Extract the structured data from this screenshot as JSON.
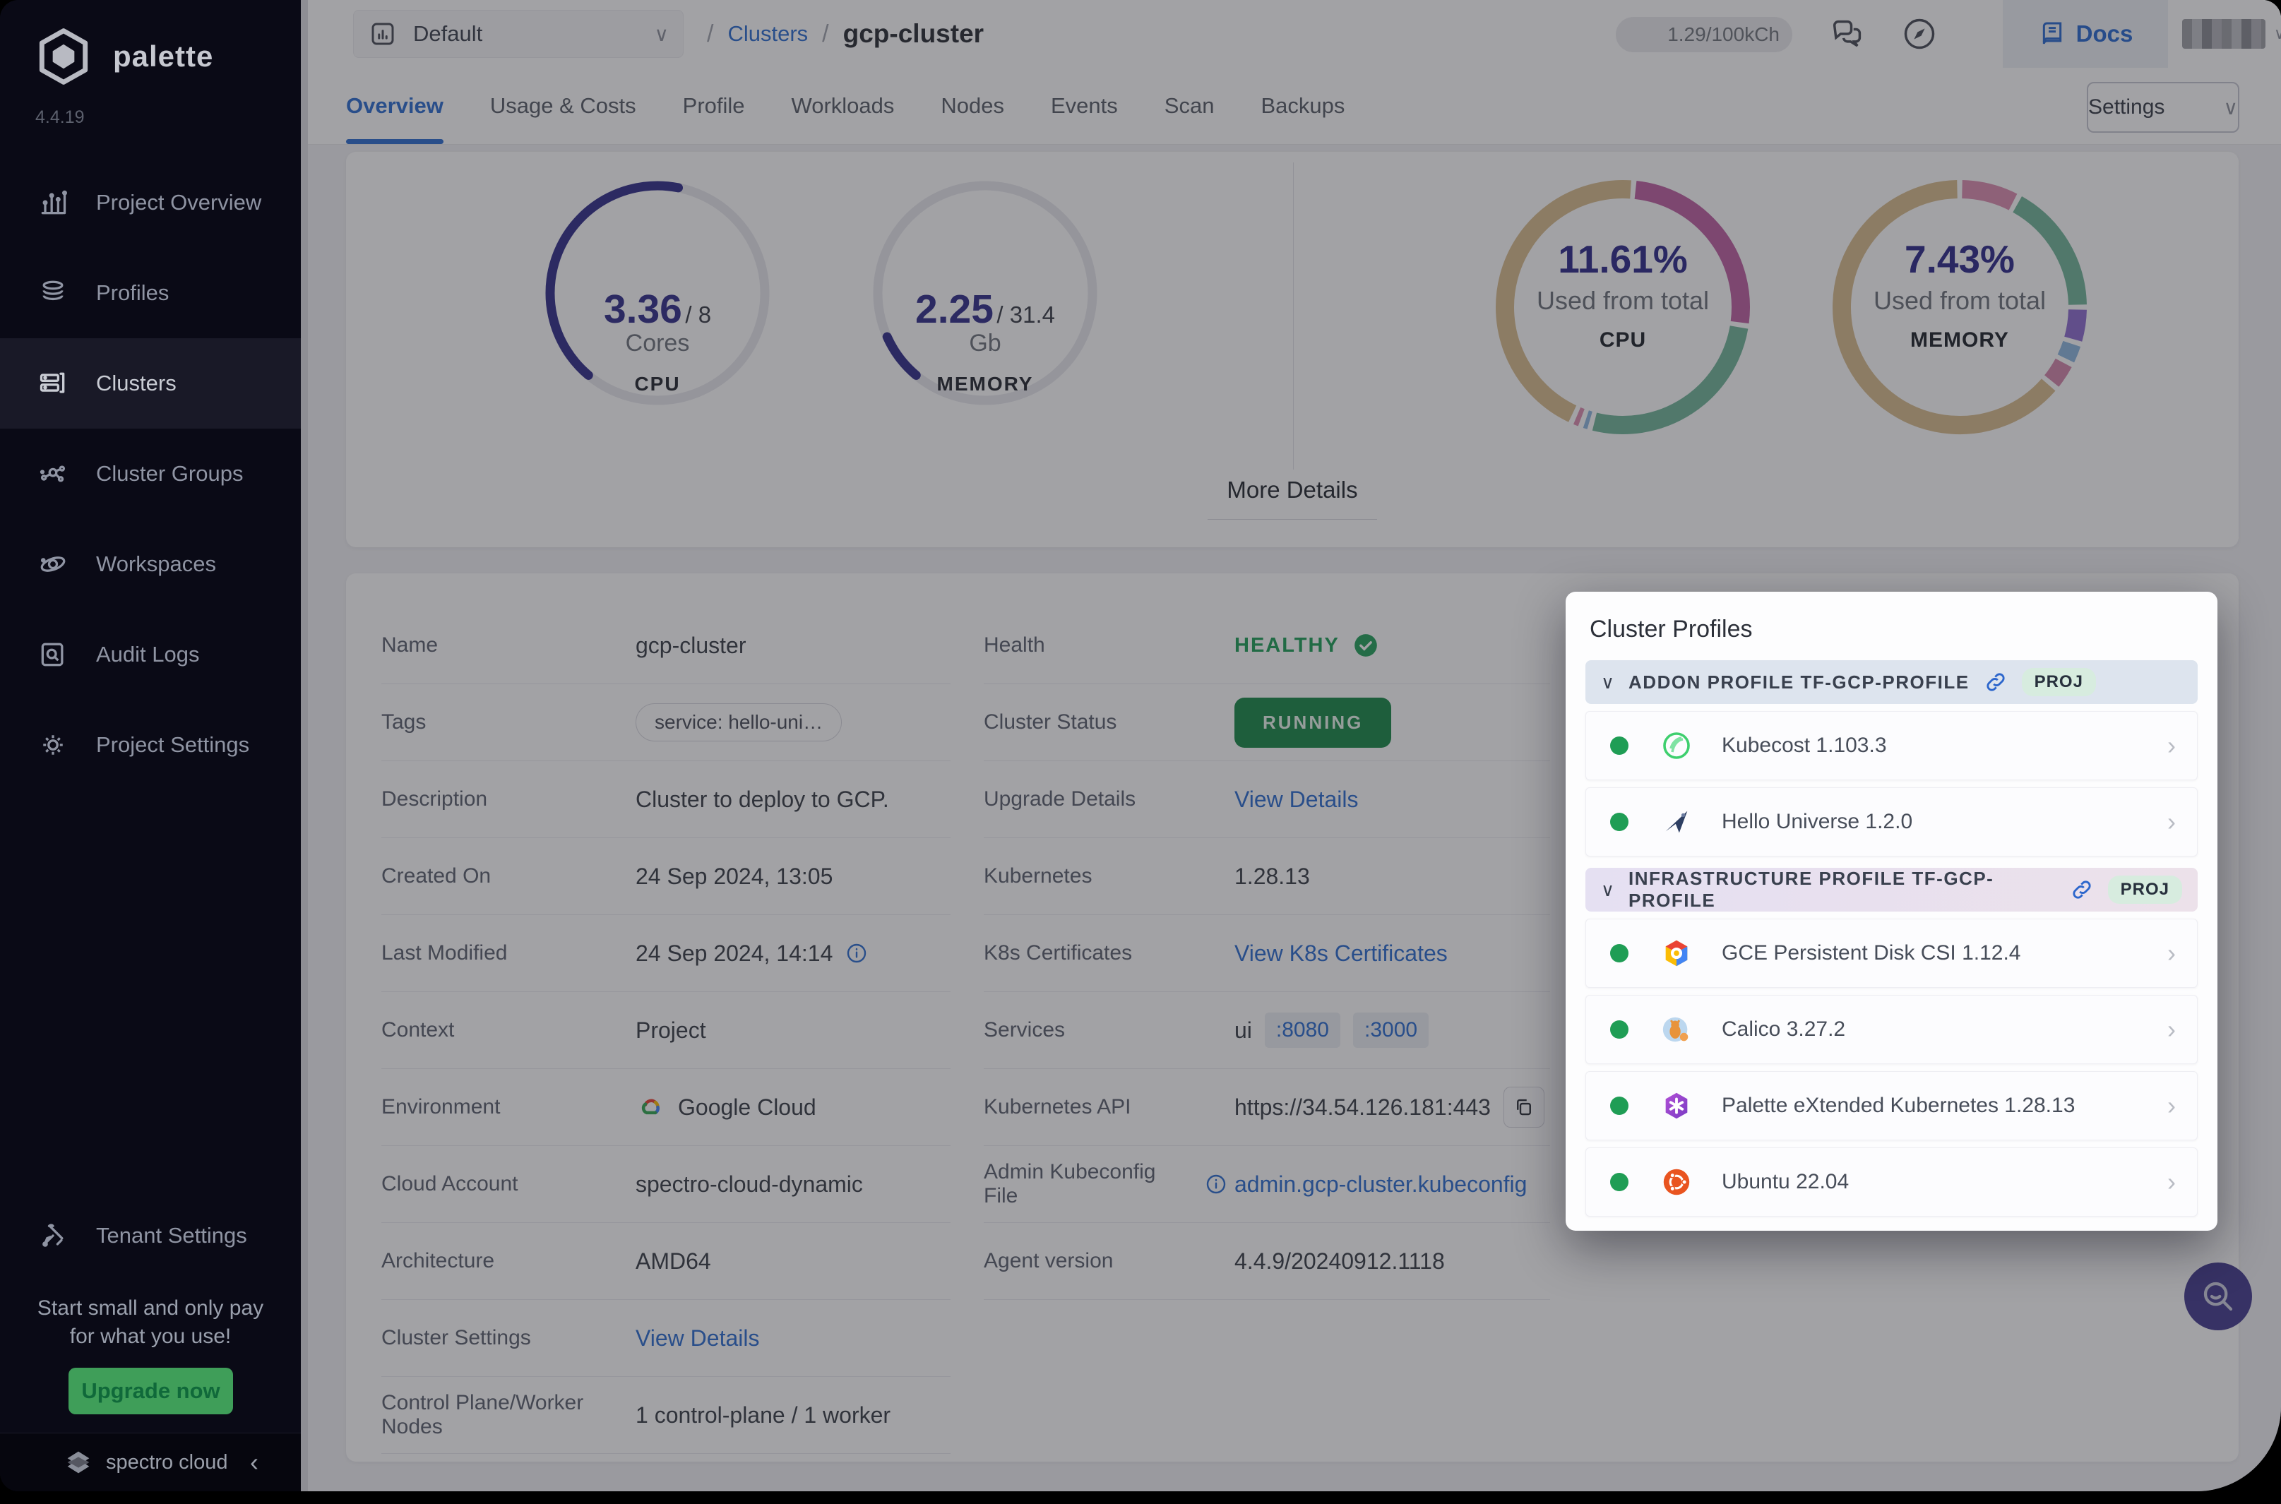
{
  "colors": {
    "accent_blue": "#2F6FD0",
    "indigo": "#34318C",
    "green": "#21944E",
    "sidebar_bg": "#0A0A16",
    "upgrade_green": "#3F9E59",
    "fab_purple": "#473E92"
  },
  "sidebar": {
    "logo_text": "palette",
    "version": "4.4.19",
    "items": [
      {
        "label": "Project Overview",
        "icon": "bar-chart-icon"
      },
      {
        "label": "Profiles",
        "icon": "layers-icon"
      },
      {
        "label": "Clusters",
        "icon": "server-icon"
      },
      {
        "label": "Cluster Groups",
        "icon": "network-icon"
      },
      {
        "label": "Workspaces",
        "icon": "orbit-icon"
      },
      {
        "label": "Audit Logs",
        "icon": "audit-icon"
      },
      {
        "label": "Project Settings",
        "icon": "gear-icon"
      }
    ],
    "active_item": "Clusters",
    "tenant_label": "Tenant Settings",
    "promo_line1": "Start small and only pay",
    "promo_line2": "for what you use!",
    "upgrade_label": "Upgrade now",
    "brand_name": "spectro cloud",
    "collapse_glyph": "‹"
  },
  "topbar": {
    "project_selector": "Default",
    "breadcrumb": {
      "sep": "/",
      "link": "Clusters",
      "current": "gcp-cluster"
    },
    "credits": "1.29/100kCh",
    "docs_label": "Docs"
  },
  "tabs": {
    "items": [
      "Overview",
      "Usage & Costs",
      "Profile",
      "Workloads",
      "Nodes",
      "Events",
      "Scan",
      "Backups"
    ],
    "active": "Overview",
    "settings_label": "Settings",
    "chevron": "∨"
  },
  "overview": {
    "gauges": [
      {
        "value": "3.36",
        "slash": "/",
        "total": "8",
        "unit": "Cores",
        "label": "CPU"
      },
      {
        "value": "2.25",
        "slash": "/",
        "total": "31.4",
        "unit": "Gb",
        "label": "MEMORY"
      }
    ],
    "donuts": [
      {
        "percent": "11.61%",
        "caption": "Used from total",
        "label": "CPU"
      },
      {
        "percent": "7.43%",
        "caption": "Used from total",
        "label": "MEMORY"
      }
    ],
    "more_details": "More Details"
  },
  "details": {
    "left": [
      {
        "label": "Name",
        "value": "gcp-cluster"
      },
      {
        "label": "Tags",
        "value": "service: hello-uni…"
      },
      {
        "label": "Description",
        "value": "Cluster to deploy to GCP."
      },
      {
        "label": "Created On",
        "value": "24 Sep 2024, 13:05"
      },
      {
        "label": "Last Modified",
        "value": "24 Sep 2024, 14:14"
      },
      {
        "label": "Context",
        "value": "Project"
      },
      {
        "label": "Environment",
        "value": "Google Cloud"
      },
      {
        "label": "Cloud Account",
        "value": "spectro-cloud-dynamic"
      },
      {
        "label": "Architecture",
        "value": "AMD64"
      },
      {
        "label": "Cluster Settings",
        "value": "View Details"
      },
      {
        "label": "Control Plane/Worker Nodes",
        "value": "1 control-plane / 1 worker"
      }
    ],
    "right": [
      {
        "label": "Health",
        "value": "HEALTHY"
      },
      {
        "label": "Cluster Status",
        "value": "RUNNING"
      },
      {
        "label": "Upgrade Details",
        "value": "View Details"
      },
      {
        "label": "Kubernetes",
        "value": "1.28.13"
      },
      {
        "label": "K8s Certificates",
        "value": "View K8s Certificates"
      },
      {
        "label": "Services",
        "value": "ui",
        "port1": ":8080",
        "port2": ":3000"
      },
      {
        "label": "Kubernetes API",
        "value": "https://34.54.126.181:443"
      },
      {
        "label": "Admin Kubeconfig File",
        "value": "admin.gcp-cluster.kubeconfig"
      },
      {
        "label": "Agent version",
        "value": "4.4.9/20240912.1118"
      }
    ]
  },
  "profiles_panel": {
    "title": "Cluster Profiles",
    "sections": [
      {
        "name": "ADDON PROFILE TF-GCP-PROFILE",
        "badge": "PROJ",
        "items": [
          {
            "name": "Kubecost 1.103.3",
            "icon": "kubecost-logo"
          },
          {
            "name": "Hello Universe 1.2.0",
            "icon": "hello-universe-logo"
          }
        ]
      },
      {
        "name": "INFRASTRUCTURE PROFILE TF-GCP-PROFILE",
        "badge": "PROJ",
        "items": [
          {
            "name": "GCE Persistent Disk CSI 1.12.4",
            "icon": "gce-logo"
          },
          {
            "name": "Calico 3.27.2",
            "icon": "calico-logo"
          },
          {
            "name": "Palette eXtended Kubernetes 1.28.13",
            "icon": "pxk-logo"
          },
          {
            "name": "Ubuntu 22.04",
            "icon": "ubuntu-logo"
          }
        ]
      }
    ]
  },
  "chart_data": [
    {
      "type": "gauge",
      "label": "CPU",
      "value": 3.36,
      "total": 8,
      "unit": "Cores",
      "fraction": 0.42,
      "start_angle": 220,
      "color": "#34318C"
    },
    {
      "type": "gauge",
      "label": "MEMORY",
      "value": 2.25,
      "total": 31.4,
      "unit": "Gb",
      "fraction": 0.072,
      "start_angle": 220,
      "color": "#34318C"
    },
    {
      "type": "donut",
      "label": "CPU",
      "percent": 11.61,
      "caption": "Used from total",
      "start_angle": 5,
      "segments": [
        {
          "name": "magenta",
          "color": "#BF62A4",
          "fraction": 0.26
        },
        {
          "name": "green",
          "color": "#74B79B",
          "fraction": 0.268
        },
        {
          "name": "blue",
          "color": "#8FB8E0",
          "fraction": 0.012
        },
        {
          "name": "pink",
          "color": "#DD90B2",
          "fraction": 0.013
        },
        {
          "name": "tan",
          "color": "#D9BD90",
          "fraction": 0.447
        }
      ]
    },
    {
      "type": "donut",
      "label": "MEMORY",
      "percent": 7.43,
      "caption": "Used from total",
      "start_angle": 0,
      "segments": [
        {
          "name": "pink",
          "color": "#DD90B2",
          "fraction": 0.078
        },
        {
          "name": "green",
          "color": "#74B79B",
          "fraction": 0.172
        },
        {
          "name": "purple",
          "color": "#8F6FD0",
          "fraction": 0.047
        },
        {
          "name": "blue",
          "color": "#8FB8E0",
          "fraction": 0.028
        },
        {
          "name": "pink2",
          "color": "#D489AC",
          "fraction": 0.036
        },
        {
          "name": "tan",
          "color": "#D9BD90",
          "fraction": 0.639
        }
      ]
    }
  ]
}
